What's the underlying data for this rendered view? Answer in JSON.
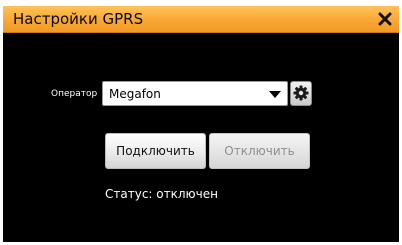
{
  "window": {
    "title": "Настройки GPRS",
    "close_icon": "close-icon"
  },
  "operator": {
    "label": "Оператор",
    "selected": "Megafon",
    "dropdown_icon": "chevron-down-icon",
    "settings_icon": "gear-icon"
  },
  "buttons": {
    "connect_label": "Подключить",
    "disconnect_label": "Отключить"
  },
  "status": {
    "text": "Статус: отключен"
  },
  "colors": {
    "titlebar": "#f9a736",
    "background": "#000000",
    "disabled_text": "#8f8f8f"
  }
}
